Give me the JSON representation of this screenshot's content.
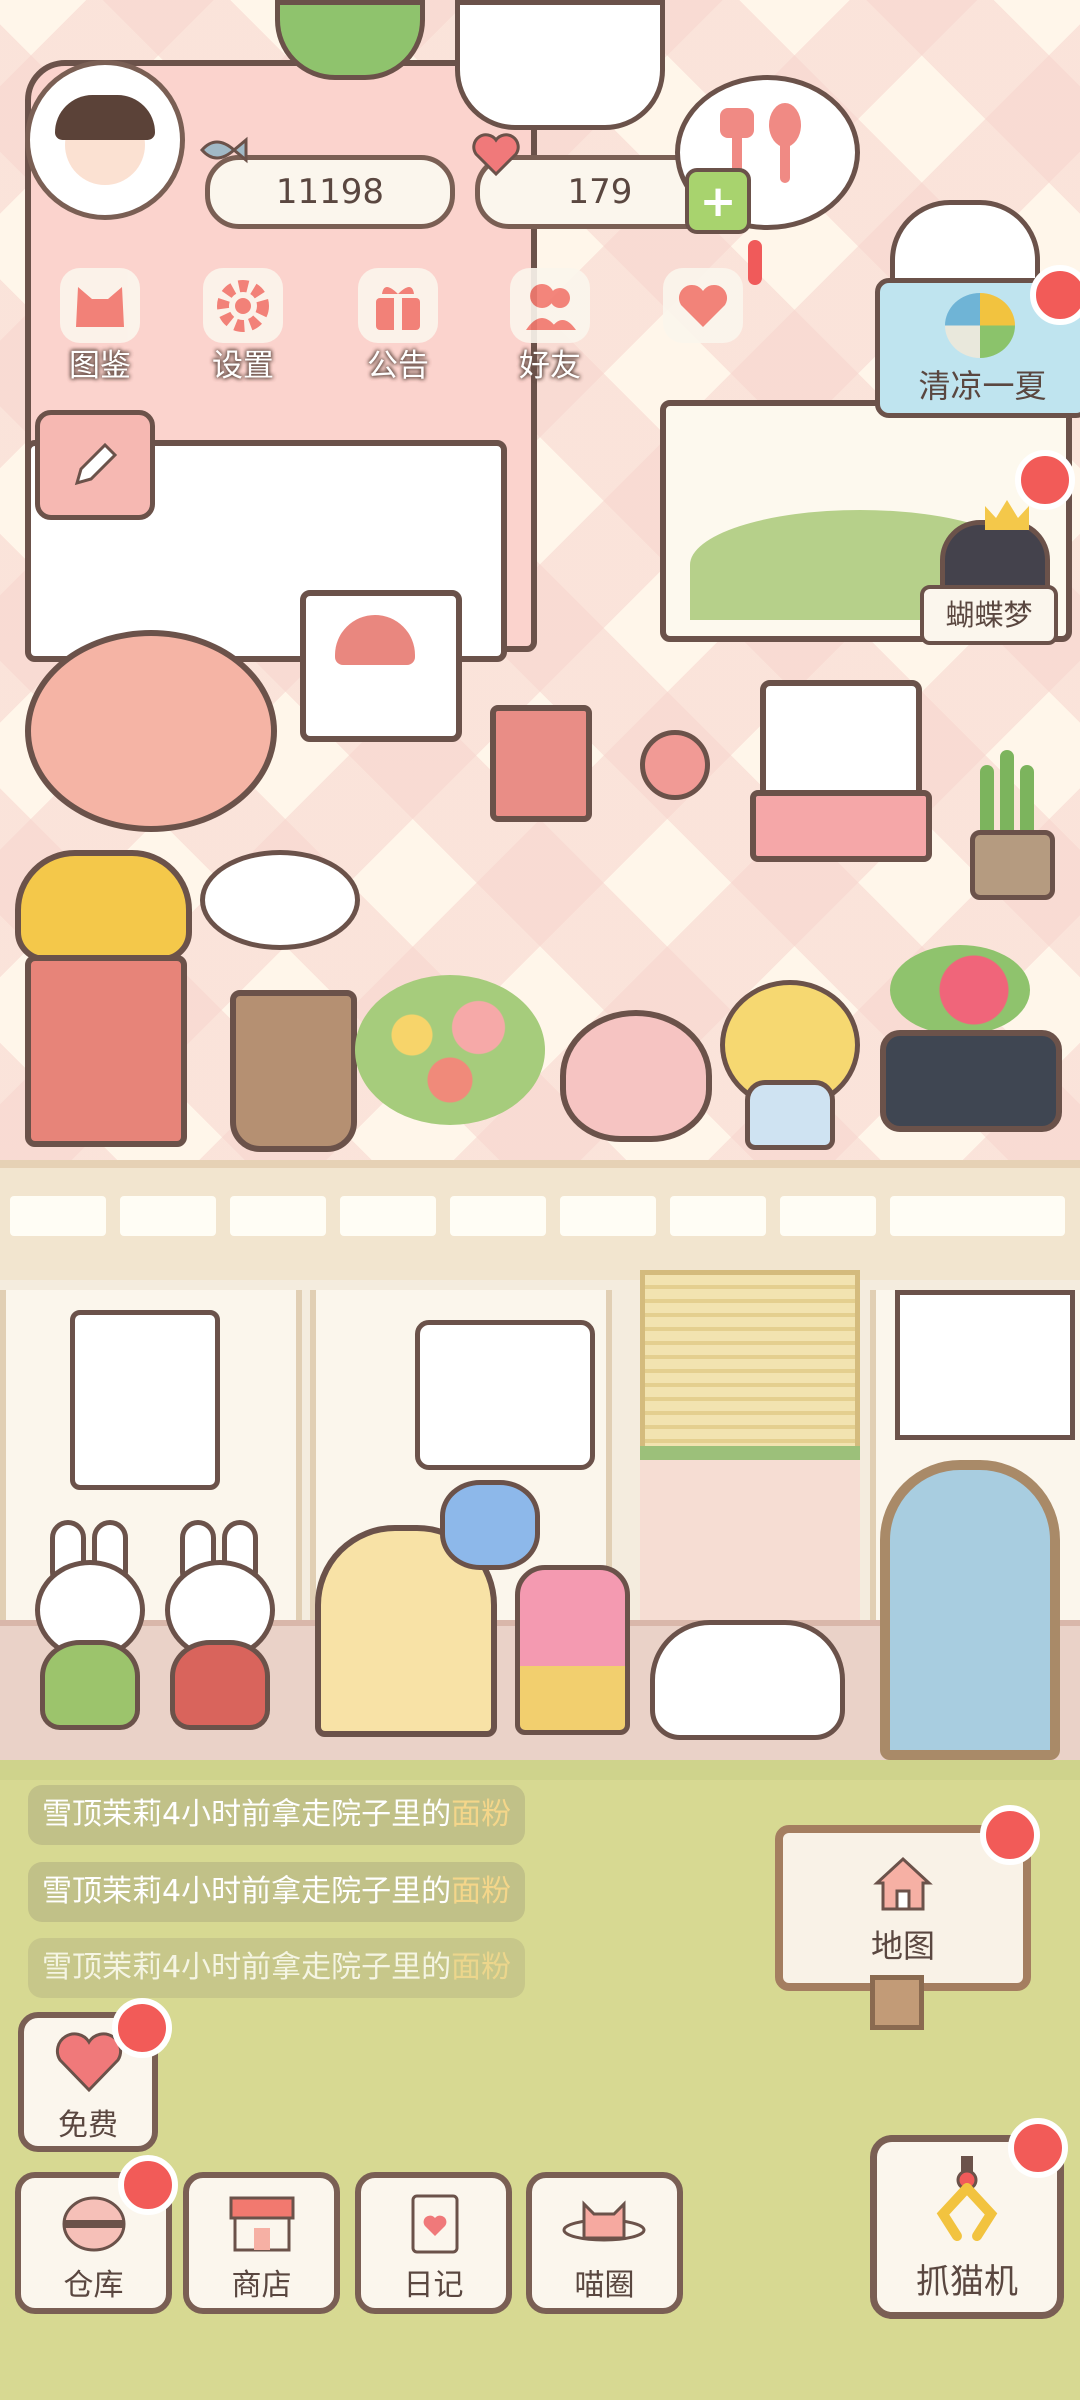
{
  "hud": {
    "fish_count": "11198",
    "heart_count": "179"
  },
  "top_menu": [
    {
      "label": "图鉴",
      "icon": "cat-face-icon"
    },
    {
      "label": "设置",
      "icon": "gear-icon"
    },
    {
      "label": "公告",
      "icon": "gift-icon"
    },
    {
      "label": "好友",
      "icon": "friends-icon"
    },
    {
      "label": "",
      "icon": "heart-message-icon"
    }
  ],
  "event_banner": {
    "label": "清凉一夏"
  },
  "side_event": {
    "label": "蝴蝶梦"
  },
  "activity_feed": [
    {
      "name": "雪顶茉莉",
      "text": "4小时前拿走院子里的",
      "item": "面粉"
    },
    {
      "name": "雪顶茉莉",
      "text": "4小时前拿走院子里的",
      "item": "面粉"
    },
    {
      "name": "雪顶茉莉",
      "text": "4小时前拿走院子里的",
      "item": "面粉"
    }
  ],
  "map_button": {
    "label": "地图",
    "icon": "house-icon"
  },
  "free_button": {
    "label": "免费",
    "icon": "heart-icon"
  },
  "bottom_nav": [
    {
      "label": "仓库",
      "icon": "storage-icon"
    },
    {
      "label": "商店",
      "icon": "shop-icon"
    },
    {
      "label": "日记",
      "icon": "diary-icon"
    },
    {
      "label": "喵圈",
      "icon": "cat-planet-icon"
    }
  ],
  "claw_machine": {
    "label": "抓猫机",
    "icon": "claw-icon"
  },
  "colors": {
    "badge_red": "#f25b58",
    "outline": "#6b524a",
    "ground": "#d7d992",
    "floor": "#fff6ea"
  }
}
